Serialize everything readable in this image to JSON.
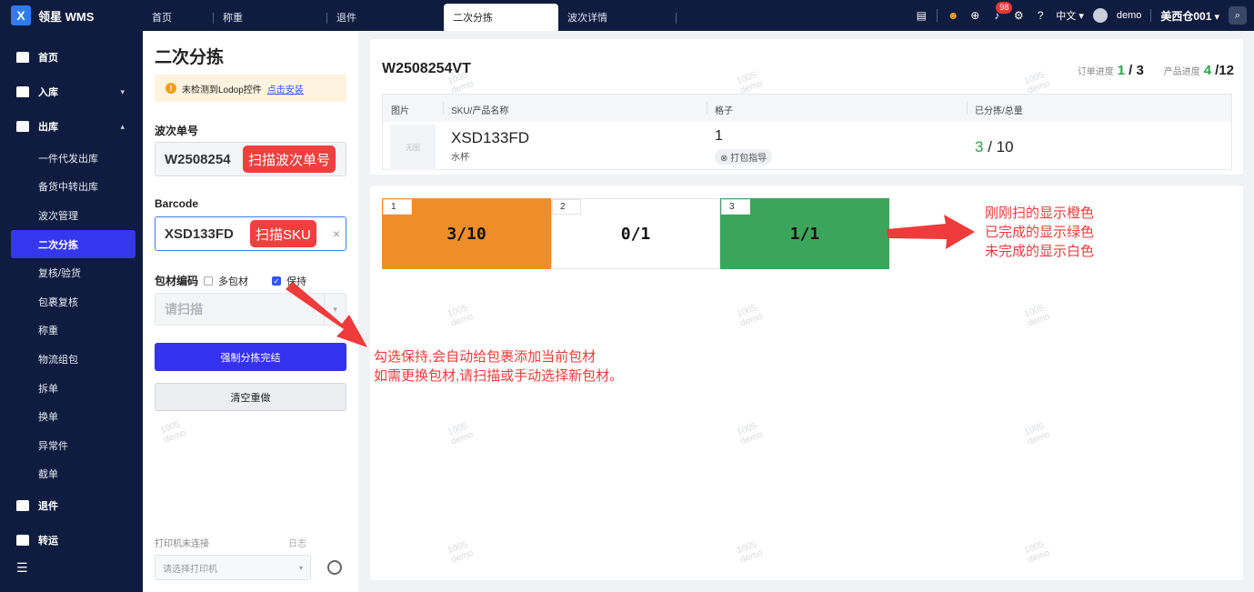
{
  "header": {
    "brand_logo": "X",
    "brand": "领星 WMS",
    "tabs": [
      "首页",
      "称重",
      "退件",
      "二次分拣",
      "波次详情"
    ],
    "active_tab": "二次分拣",
    "notification_count": "98",
    "language": "中文",
    "user": "demo",
    "warehouse": "美西仓001"
  },
  "sidebar": {
    "home": "首页",
    "inbound": "入库",
    "outbound": "出库",
    "outbound_items": [
      "一件代发出库",
      "备货中转出库",
      "波次管理",
      "二次分拣",
      "复核/验货",
      "包裹复核",
      "称重",
      "物流组包",
      "拆单",
      "换单",
      "异常件",
      "截单"
    ],
    "returns": "退件",
    "transfer": "转运"
  },
  "left": {
    "title": "二次分拣",
    "lodop_warning": "未检测到Lodop控件",
    "lodop_link": "点击安装",
    "wave_label": "波次单号",
    "wave_value": "W2508254",
    "barcode_label": "Barcode",
    "barcode_value": "XSD133FD",
    "package_label": "包材编码",
    "multi_package": "多包材",
    "keep": "保持",
    "scan_placeholder": "请扫描",
    "force_complete": "强制分拣完结",
    "clear_redo": "清空重做",
    "printer_status": "打印机未连接",
    "log": "日志",
    "printer_placeholder": "请选择打印机"
  },
  "main": {
    "wave_no": "W2508254VT",
    "order_progress_label": "订单进度",
    "order_progress_done": "1",
    "order_progress_total": "/ 3",
    "product_progress_label": "产品进度",
    "product_progress_done": "4",
    "product_progress_total": "/12",
    "columns": [
      "图片",
      "SKU/产品名称",
      "格子",
      "已分拣/总量"
    ],
    "row": {
      "thumb": "无图",
      "sku": "XSD133FD",
      "name": "水杯",
      "slot": "1",
      "pack_guide": "打包指导",
      "sorted_done": "3",
      "sorted_total": " / 10"
    },
    "slots": [
      {
        "num": "1",
        "value": "3/10",
        "state": "orange"
      },
      {
        "num": "2",
        "value": "0/1",
        "state": "white"
      },
      {
        "num": "3",
        "value": "1/1",
        "state": "green"
      }
    ]
  },
  "annotations": {
    "tag_wave": "扫描波次单号",
    "tag_sku": "扫描SKU",
    "keep_note_1": "勾选保持,会自动给包裹添加当前包材",
    "keep_note_2": "如需更换包材,请扫描或手动选择新包材。",
    "color_note_1": "刚刚扫的显示橙色",
    "color_note_2": "已完成的显示绿色",
    "color_note_3": "未完成的显示白色"
  },
  "watermark": {
    "line1": "1005",
    "line2": "demo"
  },
  "colors": {
    "accent": "#3532ef",
    "orange": "#ef8d29",
    "green": "#3ca55c",
    "annotation": "#ee3b3b"
  }
}
